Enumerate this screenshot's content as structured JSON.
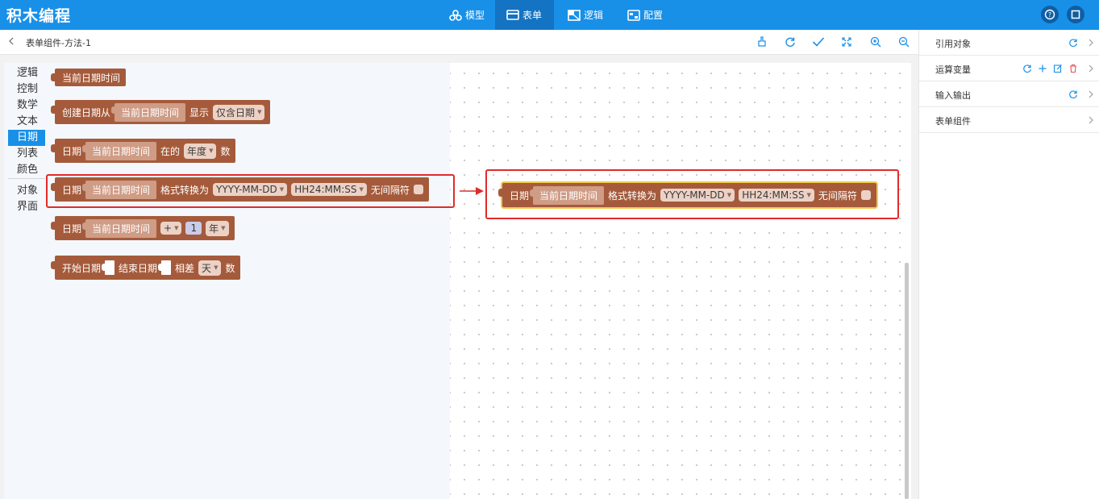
{
  "app": {
    "title": "积木编程"
  },
  "nav": [
    {
      "label": "模型",
      "icon": "cubes-icon"
    },
    {
      "label": "表单",
      "icon": "form-icon"
    },
    {
      "label": "逻辑",
      "icon": "logic-icon"
    },
    {
      "label": "配置",
      "icon": "config-icon"
    }
  ],
  "nav_active": "表单",
  "header_icons": [
    "help-icon",
    "window-icon"
  ],
  "breadcrumb": "表单组件-方法-1",
  "toolbar_icons": [
    "clean-icon",
    "refresh-icon",
    "check-icon",
    "fit-icon",
    "zoom-in-icon",
    "zoom-out-icon"
  ],
  "categories": {
    "group1": [
      "逻辑",
      "控制",
      "数学",
      "文本",
      "日期",
      "列表",
      "颜色"
    ],
    "group2": [
      "对象",
      "界面"
    ],
    "active": "日期"
  },
  "blocks": {
    "b1": {
      "label": "当前日期时间"
    },
    "b2": {
      "prefix": "创建日期从",
      "input": "当前日期时间",
      "mid": "显示",
      "dropdown": "仅含日期"
    },
    "b3": {
      "prefix": "日期",
      "input": "当前日期时间",
      "mid": "在的",
      "dropdown": "年度",
      "suffix": "数"
    },
    "b4": {
      "prefix": "日期",
      "input": "当前日期时间",
      "mid": "格式转换为",
      "dropdown1": "YYYY-MM-DD",
      "dropdown2": "HH24:MM:SS",
      "suffix": "无间隔符"
    },
    "b5": {
      "prefix": "日期",
      "input": "当前日期时间",
      "op": "+",
      "number": "1",
      "unit": "年"
    },
    "b6": {
      "prefix": "开始日期",
      "mid": "结束日期",
      "diff": "相差",
      "dropdown": "天",
      "suffix": "数"
    }
  },
  "workspace_block": {
    "prefix": "日期",
    "input": "当前日期时间",
    "mid": "格式转换为",
    "dropdown1": "YYYY-MM-DD",
    "dropdown2": "HH24:MM:SS",
    "suffix": "无间隔符"
  },
  "right_panel": [
    {
      "label": "引用对象",
      "actions": [
        "refresh-icon"
      ]
    },
    {
      "label": "运算变量",
      "actions": [
        "refresh-icon",
        "plus-icon",
        "edit-icon",
        "delete-icon"
      ]
    },
    {
      "label": "输入输出",
      "actions": [
        "refresh-icon"
      ]
    },
    {
      "label": "表单组件",
      "actions": []
    }
  ],
  "colors": {
    "brand": "#1890e8",
    "date_block": "#a55b3b",
    "highlight": "#e02b2b",
    "selected_outline": "#f2c94c"
  }
}
